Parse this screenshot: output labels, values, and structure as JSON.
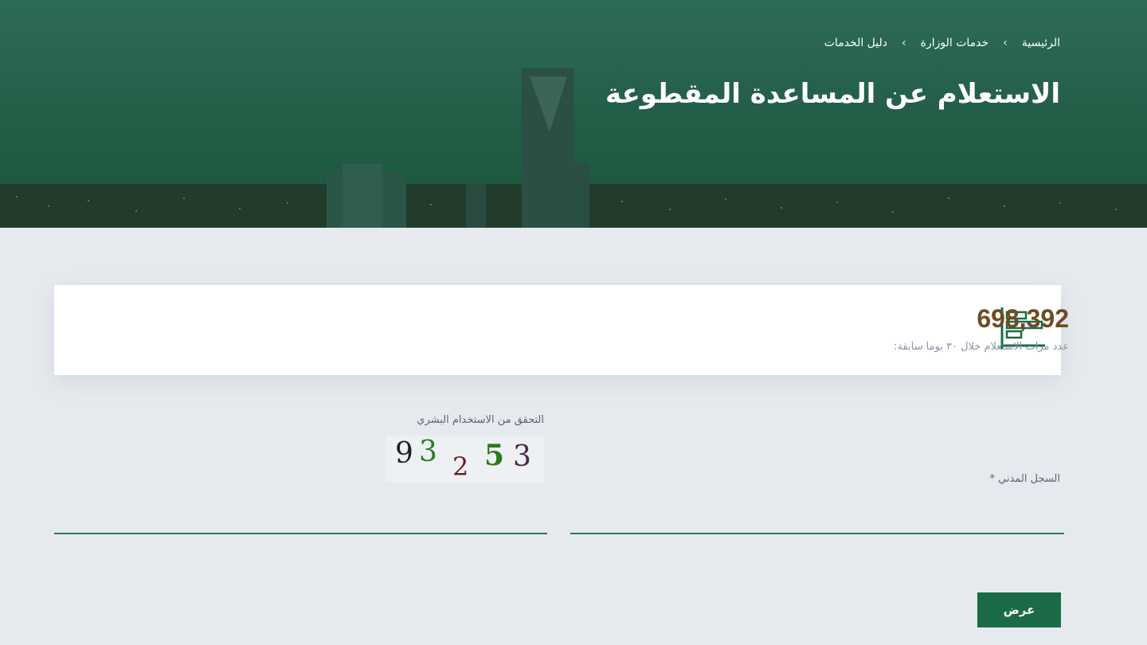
{
  "breadcrumb": {
    "items": [
      "الرئيسية",
      "خدمات الوزارة",
      "دليل الخدمات"
    ],
    "separator": "›"
  },
  "page_title": "الاستعلام عن المساعدة المقطوعة",
  "stats": {
    "count": "698,392",
    "caption": "عدد مرات الاستعلام خلال ٣٠ يوما سابقة:"
  },
  "form": {
    "civil_record_label": "السجل المدني *",
    "captcha_label": "التحقق من الاستخدام البشري",
    "captcha_text": "93253",
    "submit_label": "عرض"
  },
  "colors": {
    "primary": "#1b6b46",
    "number": "#6e4b23",
    "underline": "#2c7a4f"
  }
}
